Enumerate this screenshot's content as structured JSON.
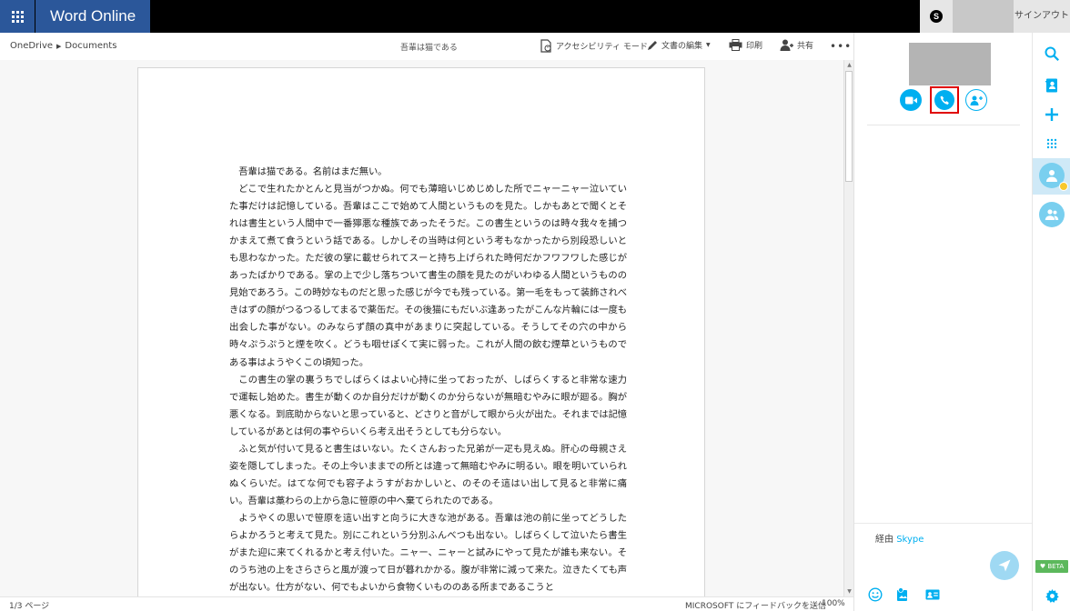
{
  "app": {
    "name": "Word Online",
    "signout_label": "サインアウト",
    "skype_logo": "S"
  },
  "command_bar": {
    "breadcrumb": [
      "OneDrive",
      "Documents"
    ],
    "doc_title": "吾輩は猫である",
    "accessibility_label": "アクセシビリティ モード",
    "edit_label": "文書の編集",
    "print_label": "印刷",
    "share_label": "共有",
    "more_label": "•••"
  },
  "document": {
    "paragraphs": [
      "吾輩は猫である。名前はまだ無い。",
      "どこで生れたかとんと見当がつかぬ。何でも薄暗いじめじめした所でニャーニャー泣いていた事だけは記憶している。吾輩はここで始めて人間というものを見た。しかもあとで聞くとそれは書生という人間中で一番獰悪な種族であったそうだ。この書生というのは時々我々を捕つかまえて煮て食うという話である。しかしその当時は何という考もなかったから別段恐しいとも思わなかった。ただ彼の掌に載せられてスーと持ち上げられた時何だかフワフワした感じがあったばかりである。掌の上で少し落ちついて書生の顔を見たのがいわゆる人間というものの見始であろう。この時妙なものだと思った感じが今でも残っている。第一毛をもって装飾されべきはずの顔がつるつるしてまるで薬缶だ。その後猫にもだいぶ逢あったがこんな片輪には一度も出会した事がない。のみならず顔の真中があまりに突起している。そうしてその穴の中から時々ぷうぷうと煙を吹く。どうも咽せぽくて実に弱った。これが人間の飲む煙草というものである事はようやくこの頃知った。",
      "この書生の掌の裏うちでしばらくはよい心持に坐っておったが、しばらくすると非常な速力で運転し始めた。書生が動くのか自分だけが動くのか分らないが無暗むやみに眼が廻る。胸が悪くなる。到底助からないと思っていると、どさりと音がして眼から火が出た。それまでは記憶しているがあとは何の事やらいくら考え出そうとしても分らない。",
      "ふと気が付いて見ると書生はいない。たくさんおった兄弟が一疋も見えぬ。肝心の母親さえ姿を隠してしまった。その上今いままでの所とは違って無暗むやみに明るい。眼を明いていられぬくらいだ。はてな何でも容子ようすがおかしいと、のそのそ這はい出して見ると非常に痛い。吾輩は藁わらの上から急に笹原の中へ棄てられたのである。",
      "ようやくの思いで笹原を這い出すと向うに大きな池がある。吾輩は池の前に坐ってどうしたらよかろうと考えて見た。別にこれという分別ふんべつも出ない。しばらくして泣いたら書生がまた迎に来てくれるかと考え付いた。ニャー、ニャーと試みにやって見たが誰も来ない。そのうち池の上をさらさらと風が渡って日が暮れかかる。腹が非常に減って来た。泣きたくても声が出ない。仕方がない、何でもよいから食物くいもののある所まであるこうと"
    ]
  },
  "status_bar": {
    "page_count": "1/3 ページ",
    "feedback": "MICROSOFT にフィードバックを送信",
    "zoom": "100%"
  },
  "skype_panel": {
    "via_prefix": "経由",
    "via_link": "Skype",
    "icons": {
      "video": "video-call-icon",
      "audio": "phone-icon",
      "add": "add-people-icon",
      "send": "send-icon",
      "emoji": "emoji-icon",
      "media": "media-icon",
      "contact": "contact-card-icon"
    }
  },
  "rail": {
    "beta_label": "♥ BETA"
  },
  "colors": {
    "word_blue": "#2b579a",
    "skype_blue": "#00aff0",
    "highlight_red": "#e00000",
    "status_away": "#f8c82c",
    "beta_green": "#5cb85c"
  }
}
